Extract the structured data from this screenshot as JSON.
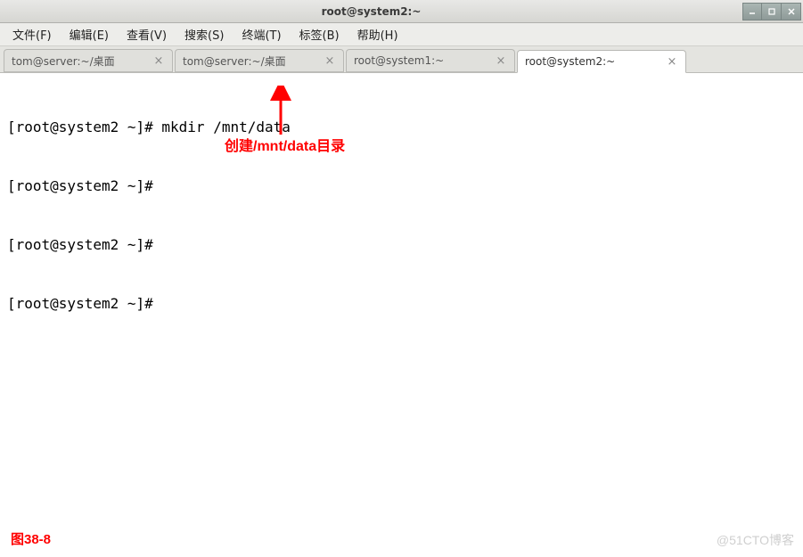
{
  "window": {
    "title": "root@system2:~"
  },
  "menubar": {
    "items": [
      "文件(F)",
      "编辑(E)",
      "查看(V)",
      "搜索(S)",
      "终端(T)",
      "标签(B)",
      "帮助(H)"
    ]
  },
  "tabs": [
    {
      "label": "tom@server:~/桌面",
      "active": false
    },
    {
      "label": "tom@server:~/桌面",
      "active": false
    },
    {
      "label": "root@system1:~",
      "active": false
    },
    {
      "label": "root@system2:~",
      "active": true
    }
  ],
  "terminal": {
    "lines": [
      "[root@system2 ~]# mkdir /mnt/data",
      "[root@system2 ~]# ",
      "[root@system2 ~]# ",
      "[root@system2 ~]# "
    ]
  },
  "annotation": {
    "text": "创建/mnt/data目录"
  },
  "figure_label": "图38-8",
  "watermark": "@51CTO博客"
}
